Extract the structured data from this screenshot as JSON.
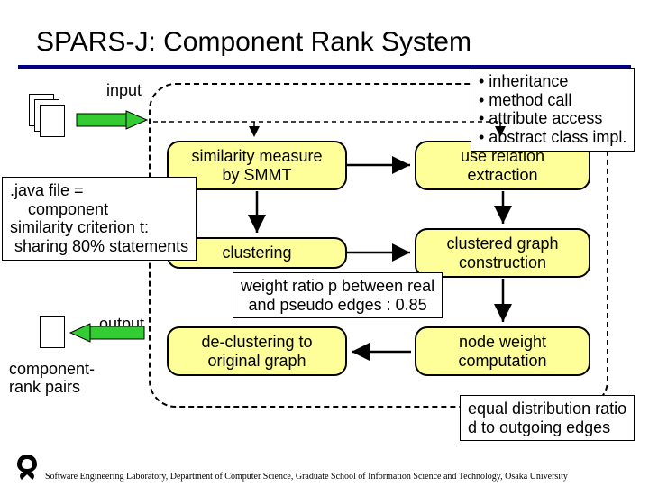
{
  "title": "SPARS-J: Component Rank System",
  "labels": {
    "input": "input",
    "output": "output",
    "component_rank_pairs": "component-\nrank pairs"
  },
  "stages": {
    "similarity": "similarity measure\nby SMMT",
    "use_relation": "use relation\nextraction",
    "clustering": "clustering",
    "clustered_graph": "clustered graph\nconstruction",
    "declustering": "de-clustering to\noriginal graph",
    "node_weight": "node weight\ncomputation"
  },
  "notes": {
    "java_file": ".java file =\n    component\nsimilarity criterion t:\n sharing 80% statements",
    "inheritance": "• inheritance\n• method call\n• attribute access\n• abstract class impl.",
    "weight_ratio": "weight ratio p between real\nand pseudo edges : 0.85",
    "equal_dist": "equal distribution ratio\nd to outgoing edges"
  },
  "footer": "Software Engineering Laboratory, Department of Computer Science, Graduate School of Information Science and Technology, Osaka University"
}
